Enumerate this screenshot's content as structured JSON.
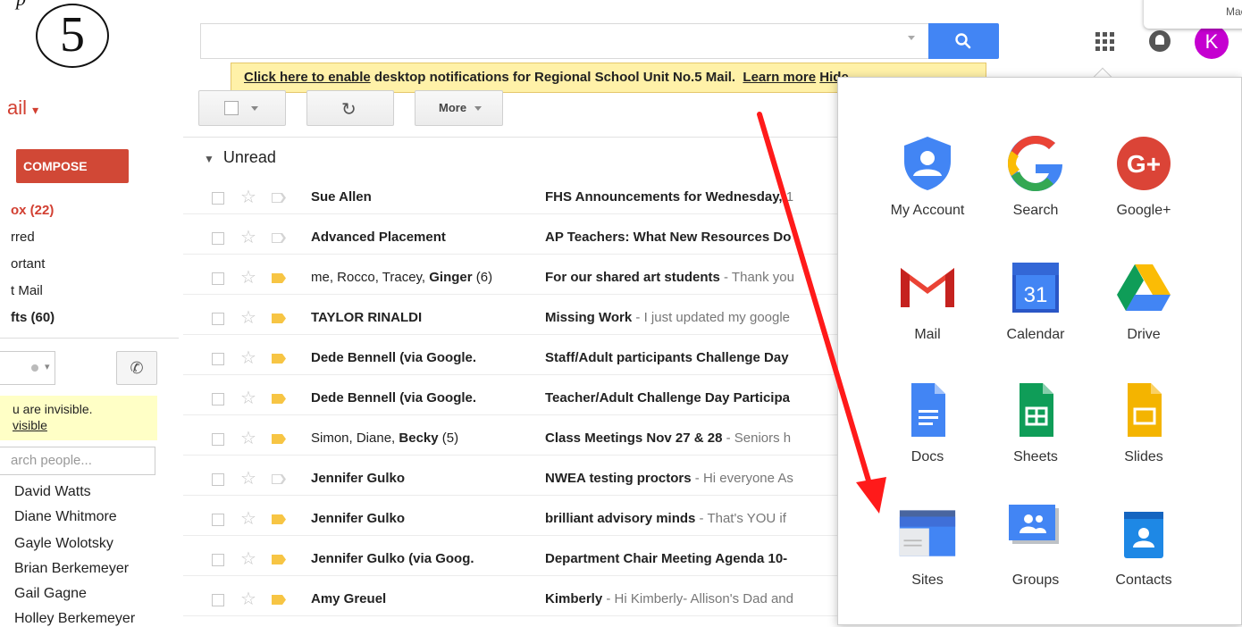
{
  "step": {
    "number": "5",
    "fragment": "p"
  },
  "mac_popup": "Mac.",
  "user_initial": "K",
  "notification": {
    "enable_link": "Click here to enable",
    "text": " desktop notifications for Regional School Unit No.5 Mail.  ",
    "learn_more": "Learn more",
    "hide": "Hide"
  },
  "toolbar": {
    "more": "More"
  },
  "sidebar": {
    "mail_label": "ail",
    "compose": "COMPOSE",
    "items": [
      "ox (22)",
      "rred",
      "ortant",
      "t Mail",
      "fts (60)"
    ],
    "chat_invisible": "u are invisible.",
    "chat_visible_link": "visible",
    "search_people_placeholder": "arch people...",
    "contacts": [
      "David Watts",
      "Diane Whitmore",
      "Gayle Wolotsky",
      "Brian Berkemeyer",
      "Gail Gagne",
      "Holley Berkemeyer"
    ]
  },
  "list": {
    "section": "Unread",
    "rows": [
      {
        "from_plain": "",
        "from_bold": "Sue Allen",
        "from_tail": "",
        "subject": "FHS Announcements for Wednesday, ",
        "snippet": "1",
        "important": false
      },
      {
        "from_plain": "",
        "from_bold": "Advanced Placement",
        "from_tail": "",
        "subject": "AP Teachers: What New Resources Do",
        "snippet": "",
        "important": false
      },
      {
        "from_plain": "me, Rocco, Tracey, ",
        "from_bold": "Ginger",
        "from_tail": " (6)",
        "subject": "For our shared art students",
        "snippet": " - Thank you",
        "important": true
      },
      {
        "from_plain": "",
        "from_bold": "TAYLOR RINALDI",
        "from_tail": "",
        "subject": "Missing Work",
        "snippet": " - I just updated my google",
        "important": true
      },
      {
        "from_plain": "",
        "from_bold": "Dede Bennell (via Google.",
        "from_tail": "",
        "subject": "Staff/Adult participants Challenge Day",
        "snippet": "",
        "important": true
      },
      {
        "from_plain": "",
        "from_bold": "Dede Bennell (via Google.",
        "from_tail": "",
        "subject": "Teacher/Adult Challenge Day Participa",
        "snippet": "",
        "important": true
      },
      {
        "from_plain": "Simon, Diane, ",
        "from_bold": "Becky",
        "from_tail": " (5)",
        "subject": "Class Meetings Nov 27 & 28",
        "snippet": " - Seniors h",
        "important": true
      },
      {
        "from_plain": "",
        "from_bold": "Jennifer Gulko",
        "from_tail": "",
        "subject": "NWEA testing proctors",
        "snippet": " - Hi everyone As",
        "important": false
      },
      {
        "from_plain": "",
        "from_bold": "Jennifer Gulko",
        "from_tail": "",
        "subject": "brilliant advisory minds",
        "snippet": " - That's YOU if",
        "important": true
      },
      {
        "from_plain": "",
        "from_bold": "Jennifer Gulko (via Goog.",
        "from_tail": "",
        "subject": "Department Chair Meeting Agenda 10-",
        "snippet": "",
        "important": true
      },
      {
        "from_plain": "",
        "from_bold": "Amy Greuel",
        "from_tail": "",
        "subject": "Kimberly",
        "snippet": " - Hi Kimberly- Allison's Dad and",
        "important": true
      }
    ]
  },
  "apps": [
    {
      "label": "My Account",
      "icon": "my-account-icon"
    },
    {
      "label": "Search",
      "icon": "google-search-icon"
    },
    {
      "label": "Google+",
      "icon": "google-plus-icon"
    },
    {
      "label": "Mail",
      "icon": "gmail-icon"
    },
    {
      "label": "Calendar",
      "icon": "calendar-icon",
      "day": "31"
    },
    {
      "label": "Drive",
      "icon": "drive-icon"
    },
    {
      "label": "Docs",
      "icon": "docs-icon"
    },
    {
      "label": "Sheets",
      "icon": "sheets-icon"
    },
    {
      "label": "Slides",
      "icon": "slides-icon"
    },
    {
      "label": "Sites",
      "icon": "sites-icon"
    },
    {
      "label": "Groups",
      "icon": "groups-icon"
    },
    {
      "label": "Contacts",
      "icon": "contacts-icon"
    }
  ],
  "colors": {
    "accent_red": "#d14836",
    "search_blue": "#4285f4",
    "notification_bg": "#fff1a8",
    "annotation_arrow": "#ff1a1a"
  }
}
